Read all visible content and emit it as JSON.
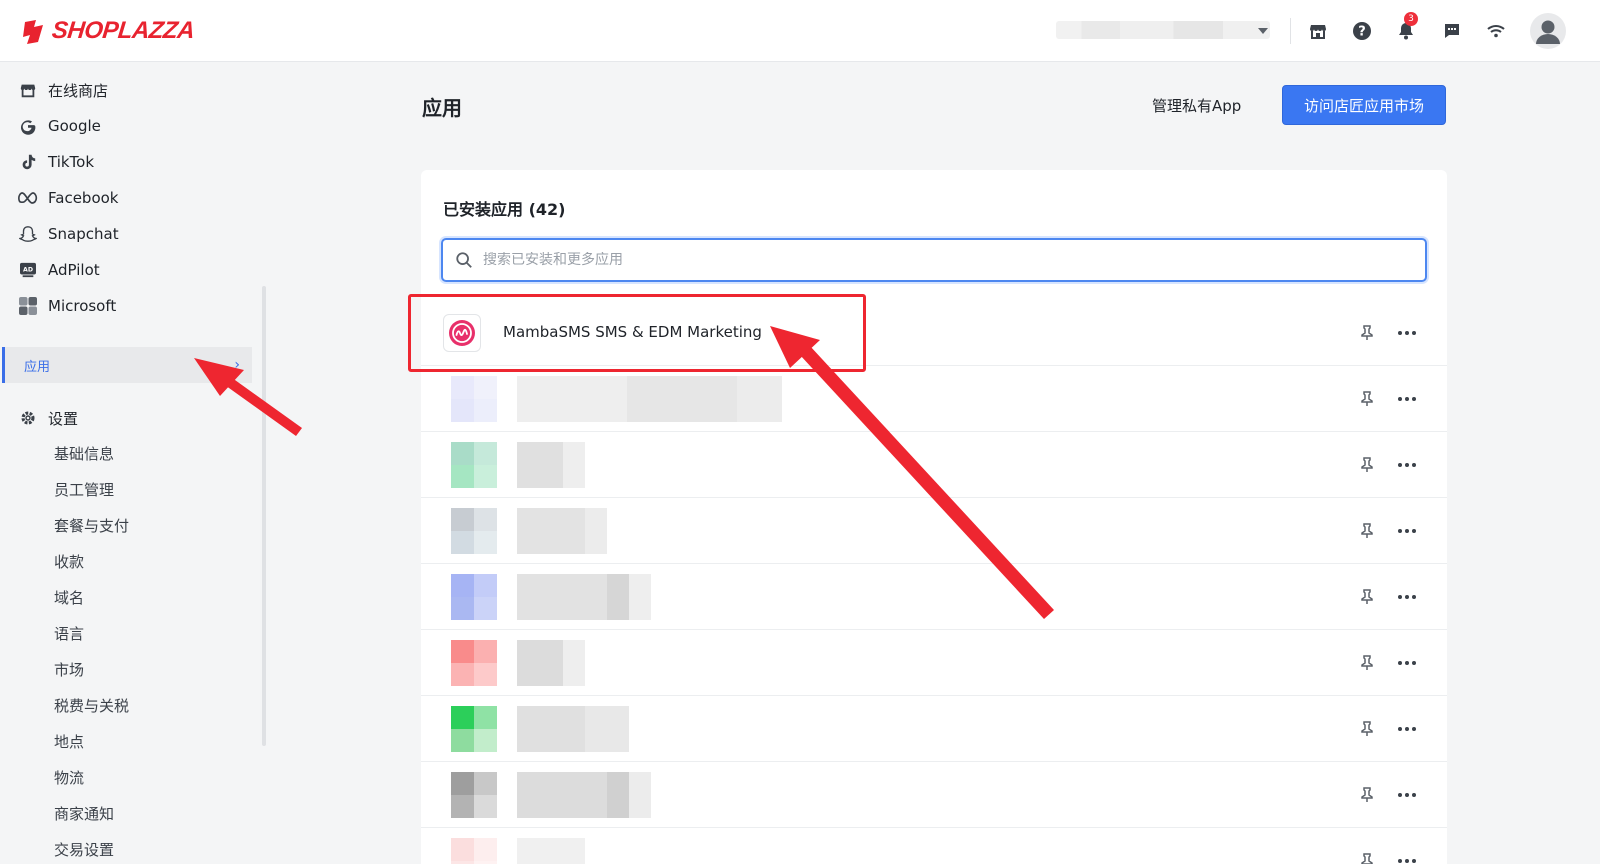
{
  "brand": {
    "name": "SHOPLAZZA",
    "color": "#e8232f"
  },
  "topbar": {
    "icons": [
      "store-icon",
      "help-icon",
      "bell-icon",
      "chat-icon",
      "wifi-icon",
      "avatar"
    ],
    "notification_count": "3"
  },
  "sidebar": {
    "channels": [
      {
        "label": "在线商店",
        "icon": "store-icon"
      },
      {
        "label": "Google",
        "icon": "google-icon"
      },
      {
        "label": "TikTok",
        "icon": "tiktok-icon"
      },
      {
        "label": "Facebook",
        "icon": "meta-icon"
      },
      {
        "label": "Snapchat",
        "icon": "snapchat-icon"
      },
      {
        "label": "AdPilot",
        "icon": "adpilot-icon"
      },
      {
        "label": "Microsoft",
        "icon": "microsoft-icon"
      }
    ],
    "apps_label": "应用",
    "settings_label": "设置",
    "settings_items": [
      "基础信息",
      "员工管理",
      "套餐与支付",
      "收款",
      "域名",
      "语言",
      "市场",
      "税费与关税",
      "地点",
      "物流",
      "商家通知",
      "交易设置"
    ]
  },
  "main": {
    "title": "应用",
    "manage_private_label": "管理私有App",
    "visit_store_label": "访问店匠应用市场",
    "installed_title": "已安装应用 (42)",
    "search_placeholder": "搜索已安装和更多应用",
    "apps": [
      {
        "name": "MambaSMS SMS & EDM Marketing",
        "icon": "mambasms-icon",
        "accent": "#e8306a"
      }
    ]
  },
  "colors": {
    "primary": "#3a77f2",
    "annotation": "#ee2630"
  }
}
